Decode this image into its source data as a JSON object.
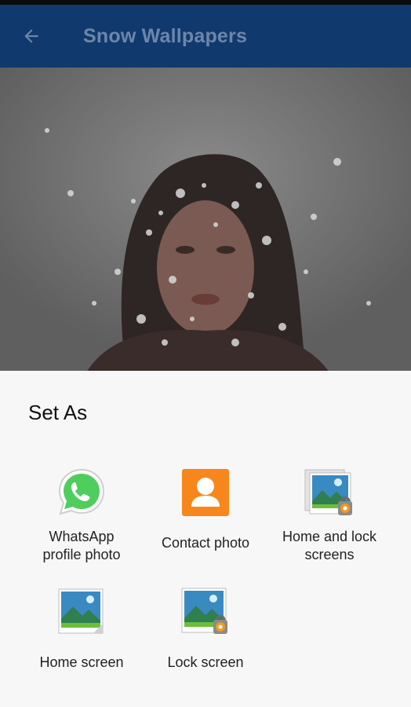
{
  "app_bar": {
    "title": "Snow Wallpapers",
    "back_icon": "arrow-back-icon",
    "background_color": "#103a6e"
  },
  "sheet": {
    "title": "Set As",
    "options": [
      {
        "label": "WhatsApp\nprofile photo",
        "icon": "whatsapp-icon"
      },
      {
        "label": "Contact photo",
        "icon": "contact-photo-icon"
      },
      {
        "label": "Home and lock\nscreens",
        "icon": "home-lock-screens-icon"
      },
      {
        "label": "Home screen",
        "icon": "home-screen-icon"
      },
      {
        "label": "Lock screen",
        "icon": "lock-screen-icon"
      }
    ]
  },
  "colors": {
    "whatsapp_green": "#4fce5d",
    "contact_orange": "#f7871c",
    "sheet_background": "#f7f7f7"
  }
}
